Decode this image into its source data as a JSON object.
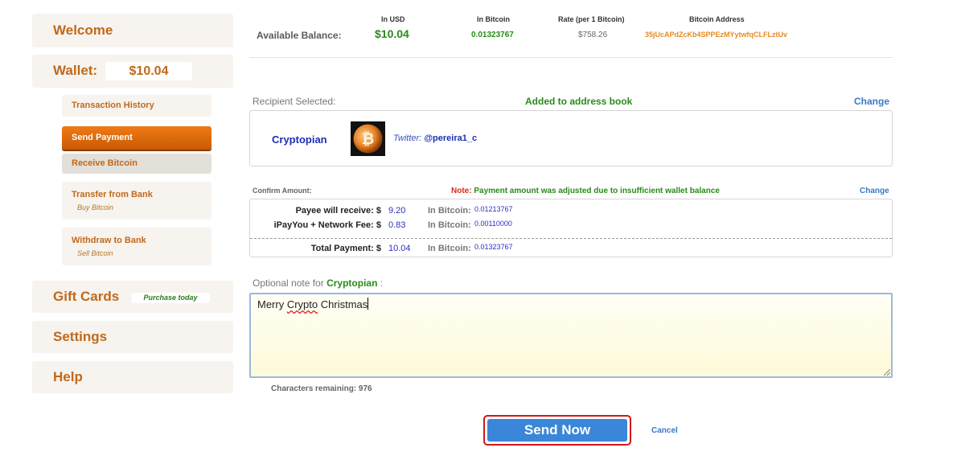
{
  "sidebar": {
    "welcome": "Welcome",
    "wallet_label": "Wallet:",
    "wallet_amount": "$10.04",
    "items": [
      {
        "label": "Transaction History",
        "caption": ""
      },
      {
        "label": "Send Payment",
        "caption": ""
      },
      {
        "label": "Receive Bitcoin",
        "caption": ""
      },
      {
        "label": "Transfer from Bank",
        "caption": "Buy Bitcoin"
      },
      {
        "label": "Withdraw to Bank",
        "caption": "Sell Bitcoin"
      }
    ],
    "gift_cards": "Gift Cards",
    "gift_cards_pill": "Purchase today",
    "settings": "Settings",
    "help": "Help"
  },
  "balance": {
    "headers": {
      "usd": "In USD",
      "btc": "In Bitcoin",
      "rate": "Rate (per 1 Bitcoin)",
      "address": "Bitcoin Address"
    },
    "label": "Available Balance:",
    "usd": "$10.04",
    "btc": "0.01323767",
    "rate": "$758.26",
    "address": "35jUcAPdZcKb4SPPEzMYytwfqCLFLztUv"
  },
  "recipient": {
    "label": "Recipient Selected:",
    "status": "Added to address book",
    "change": "Change",
    "name": "Cryptopian",
    "twitter_label": "Twitter:",
    "twitter_handle": "@pereira1_c"
  },
  "amount": {
    "label": "Confirm Amount:",
    "note_prefix": "Note:",
    "note_text": "Payment amount was adjusted due to insufficient wallet balance",
    "change": "Change",
    "rows": [
      {
        "label": "Payee will receive: $",
        "value": "9.20",
        "btc_label": "In Bitcoin:",
        "btc": "0.01213767"
      },
      {
        "label": "iPayYou + Network Fee: $",
        "value": "0.83",
        "btc_label": "In Bitcoin:",
        "btc": "0.00110000"
      },
      {
        "label": "Total Payment: $",
        "value": "10.04",
        "btc_label": "In Bitcoin:",
        "btc": "0.01323767"
      }
    ]
  },
  "note": {
    "label_prefix": "Optional note for",
    "recipient": "Cryptopian",
    "label_suffix": ":",
    "text_before": "Merry ",
    "text_misspelled": "Crypto",
    "text_after": " Christmas",
    "chars_remaining": "Characters remaining: 976"
  },
  "actions": {
    "send": "Send Now",
    "cancel": "Cancel"
  },
  "colors": {
    "brand_orange": "#c0691b",
    "accent_green": "#2a8a1a",
    "link_blue": "#3a78c8",
    "send_button": "#3a86d8",
    "highlight_ring": "#d41616"
  }
}
